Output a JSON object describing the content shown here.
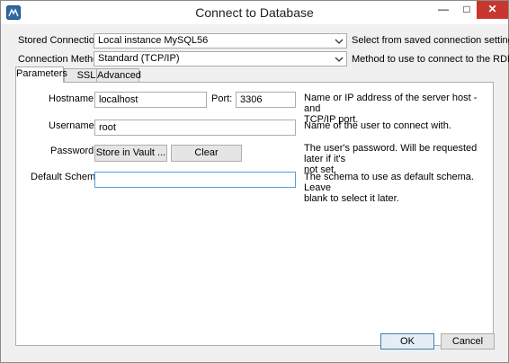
{
  "window": {
    "title": "Connect to Database",
    "controls": {
      "minimize": "—",
      "maximize": "□",
      "close": "✕"
    }
  },
  "top": {
    "stored_connection": {
      "label": "Stored Connection:",
      "value": "Local instance MySQL56",
      "hint": "Select from saved connection settings"
    },
    "connection_method": {
      "label": "Connection Method:",
      "value": "Standard (TCP/IP)",
      "hint": "Method to use to connect to the RDBMS"
    }
  },
  "tabs": [
    {
      "label": "Parameters",
      "active": true
    },
    {
      "label": "SSL",
      "active": false
    },
    {
      "label": "Advanced",
      "active": false
    }
  ],
  "parameters": {
    "hostname": {
      "label": "Hostname:",
      "value": "localhost",
      "port_label": "Port:",
      "port_value": "3306",
      "desc_line1": "Name or IP address of the server host - and",
      "desc_line2": "TCP/IP port."
    },
    "username": {
      "label": "Username:",
      "value": "root",
      "desc": "Name of the user to connect with."
    },
    "password": {
      "label": "Password:",
      "store_button": "Store in Vault ...",
      "clear_button": "Clear",
      "desc_line1": "The user's password. Will be requested later if it's",
      "desc_line2": "not set."
    },
    "default_schema": {
      "label": "Default Schema:",
      "value": "",
      "desc_line1": "The schema to use as default schema. Leave",
      "desc_line2": "blank to select it later."
    }
  },
  "footer": {
    "ok": "OK",
    "cancel": "Cancel"
  },
  "colors": {
    "close_button": "#c7372f",
    "focus_border": "#569de5",
    "dialog_background": "#f0f0f0"
  },
  "icons": {
    "app": "mysql-workbench-app-icon",
    "dropdown": "chevron-down-icon"
  }
}
